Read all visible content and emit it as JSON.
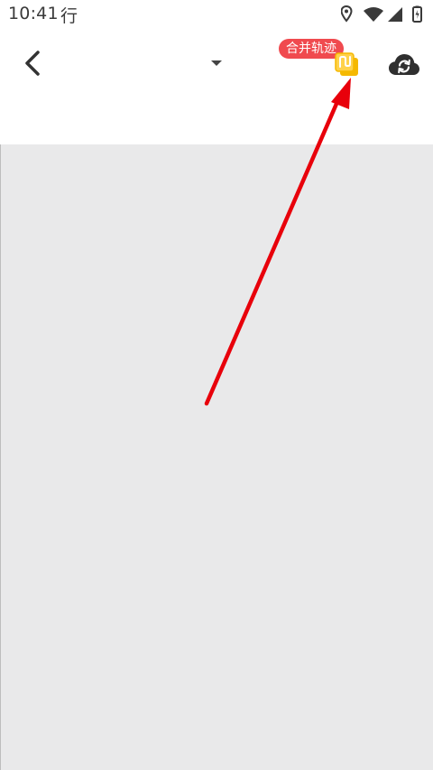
{
  "status_bar": {
    "time": "10:41",
    "extra_text": "行",
    "icons": [
      "location-icon",
      "wifi-icon",
      "cellular-signal-icon",
      "battery-icon"
    ]
  },
  "toolbar": {
    "back_icon": "chevron-left-icon",
    "title": "",
    "dropdown_icon": "caret-down-icon",
    "merge_tip": "合并轨迹",
    "merge_icon": "merge-track-icon",
    "sync_icon": "cloud-sync-icon"
  },
  "annotation": {
    "type": "red-arrow",
    "color": "#e8000b",
    "points_to": "merge-track-button"
  },
  "colors": {
    "content_background": "#e9e9ea",
    "merge_tip_background": "#f04a4f",
    "merge_icon": "#f5b800",
    "text": "#3a3a3a"
  }
}
